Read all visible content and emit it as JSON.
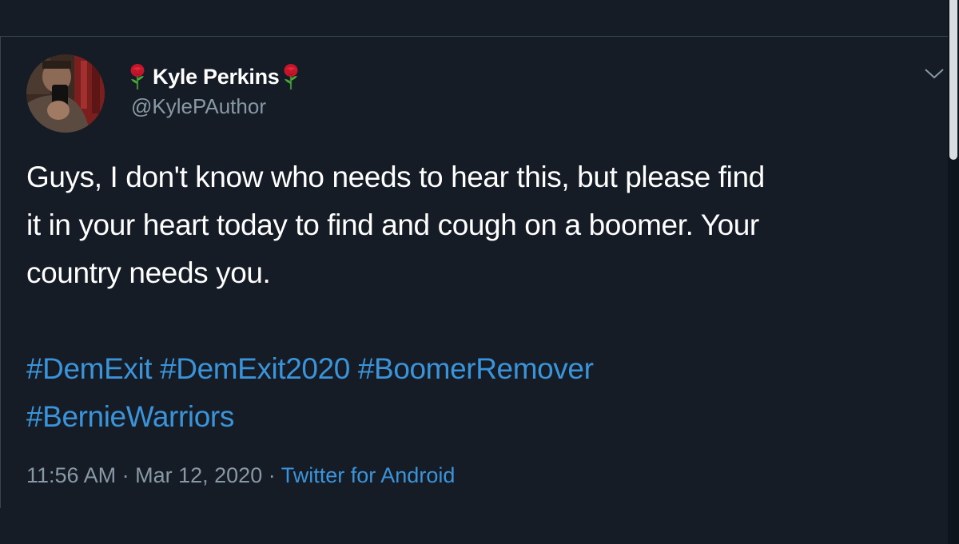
{
  "user": {
    "display_name": "Kyle Perkins",
    "handle": "@KylePAuthor",
    "name_emoji": "rose-icon"
  },
  "tweet": {
    "line1": "Guys, I don't know who needs to hear this, but please find",
    "line2": "it in your heart today to find and cough on a boomer. Your",
    "line3": "country needs you.",
    "hashtags": [
      "#DemExit",
      "#DemExit2020",
      "#BoomerRemover",
      "#BernieWarriors"
    ]
  },
  "meta": {
    "time": "11:56 AM",
    "separator": "·",
    "date": "Mar 12, 2020",
    "source": "Twitter for Android"
  },
  "colors": {
    "background": "#151c26",
    "text": "#ffffff",
    "muted": "#8899a6",
    "link": "#3b94d9"
  },
  "icons": [
    "avatar",
    "rose-icon",
    "chevron-down-icon"
  ]
}
